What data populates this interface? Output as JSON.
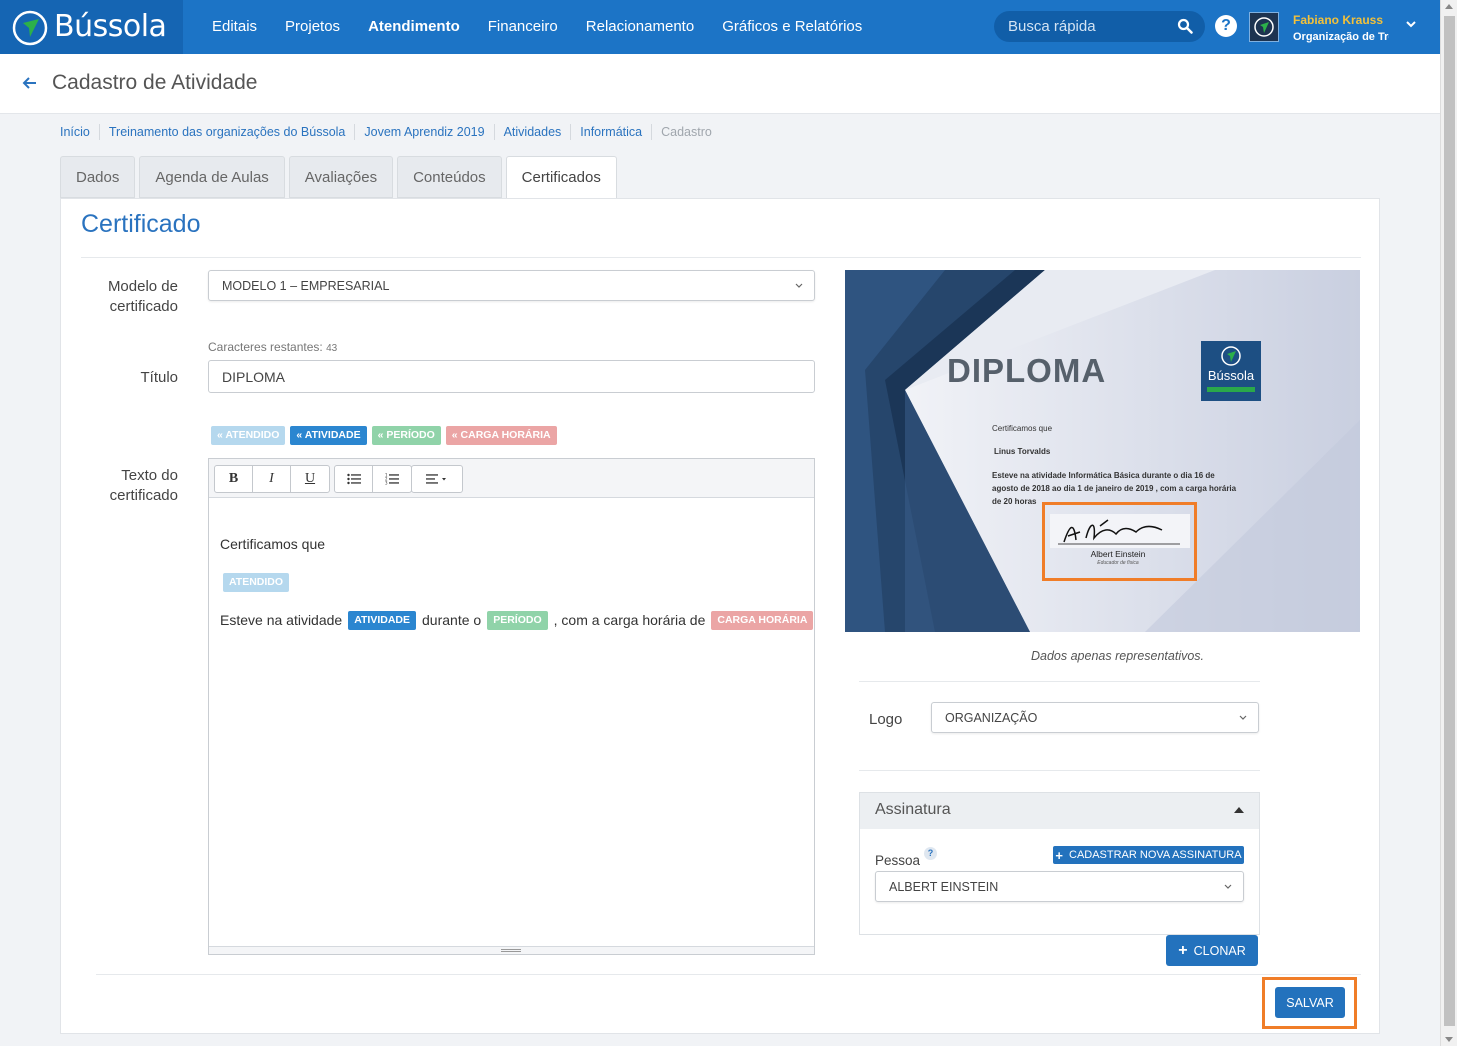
{
  "app": {
    "brand": "Bússola",
    "nav": [
      "Editais",
      "Projetos",
      "Atendimento",
      "Financeiro",
      "Relacionamento",
      "Gráficos e Relatórios"
    ],
    "active_nav": "Atendimento",
    "search_placeholder": "Busca rápida",
    "help_symbol": "?",
    "user_name": "Fabiano Krauss",
    "user_org": "Organização de Treinamento"
  },
  "page": {
    "title": "Cadastro de Atividade",
    "breadcrumb": [
      "Início",
      "Treinamento das organizações do Bússola",
      "Jovem Aprendiz 2019",
      "Atividades",
      "Informática",
      "Cadastro"
    ],
    "tabs": [
      "Dados",
      "Agenda de Aulas",
      "Avaliações",
      "Conteúdos",
      "Certificados"
    ],
    "active_tab": "Certificados"
  },
  "form": {
    "section_title": "Certificado",
    "model_label": "Modelo de certificado",
    "model_label_l1": "Modelo de",
    "model_label_l2": "certificado",
    "model_value": "MODELO 1 – EMPRESARIAL",
    "remaining_label": "Caracteres restantes:",
    "remaining_count": "43",
    "title_label": "Título",
    "title_value": "DIPLOMA",
    "tags": {
      "atendido": "« ATENDIDO",
      "atividade": "« ATIVIDADE",
      "periodo": "« PERÍODO",
      "carga": "« CARGA HORÁRIA"
    },
    "text_label_l1": "Texto do",
    "text_label_l2": "certificado",
    "toolbar": {
      "bold": "B",
      "italic": "I",
      "underline": "U"
    },
    "editor": {
      "line1": "Certificamos que",
      "tag_atendido": "ATENDIDO",
      "line3_a": "Esteve na atividade",
      "tag_atividade": "ATIVIDADE",
      "line3_b": "durante o",
      "tag_periodo": "PERÍODO",
      "line3_c": ", com a carga horária de",
      "tag_carga": "CARGA HORÁRIA"
    }
  },
  "preview": {
    "title": "DIPLOMA",
    "logo_text": "Bússola",
    "certify": "Certificamos que",
    "person": "Linus Torvalds",
    "body": "Esteve na atividade  Informática Básica  durante o  dia 16 de agosto de 2018 ao dia 1 de janeiro de 2019  , com a carga horária de  20 horas",
    "signer": "Albert Einstein",
    "signer_role": "Educador de física",
    "note": "Dados apenas representativos."
  },
  "logo": {
    "label": "Logo",
    "value": "ORGANIZAÇÃO"
  },
  "signature": {
    "panel_title": "Assinatura",
    "person_label": "Pessoa",
    "person_help": "?",
    "new_button": "CADASTRAR NOVA ASSINATURA",
    "person_value": "ALBERT EINSTEIN"
  },
  "actions": {
    "clone": "CLONAR",
    "save": "SALVAR"
  },
  "colors": {
    "primary": "#1c74c6",
    "accent_highlight": "#f07d28",
    "user_name": "#f3c13a"
  }
}
